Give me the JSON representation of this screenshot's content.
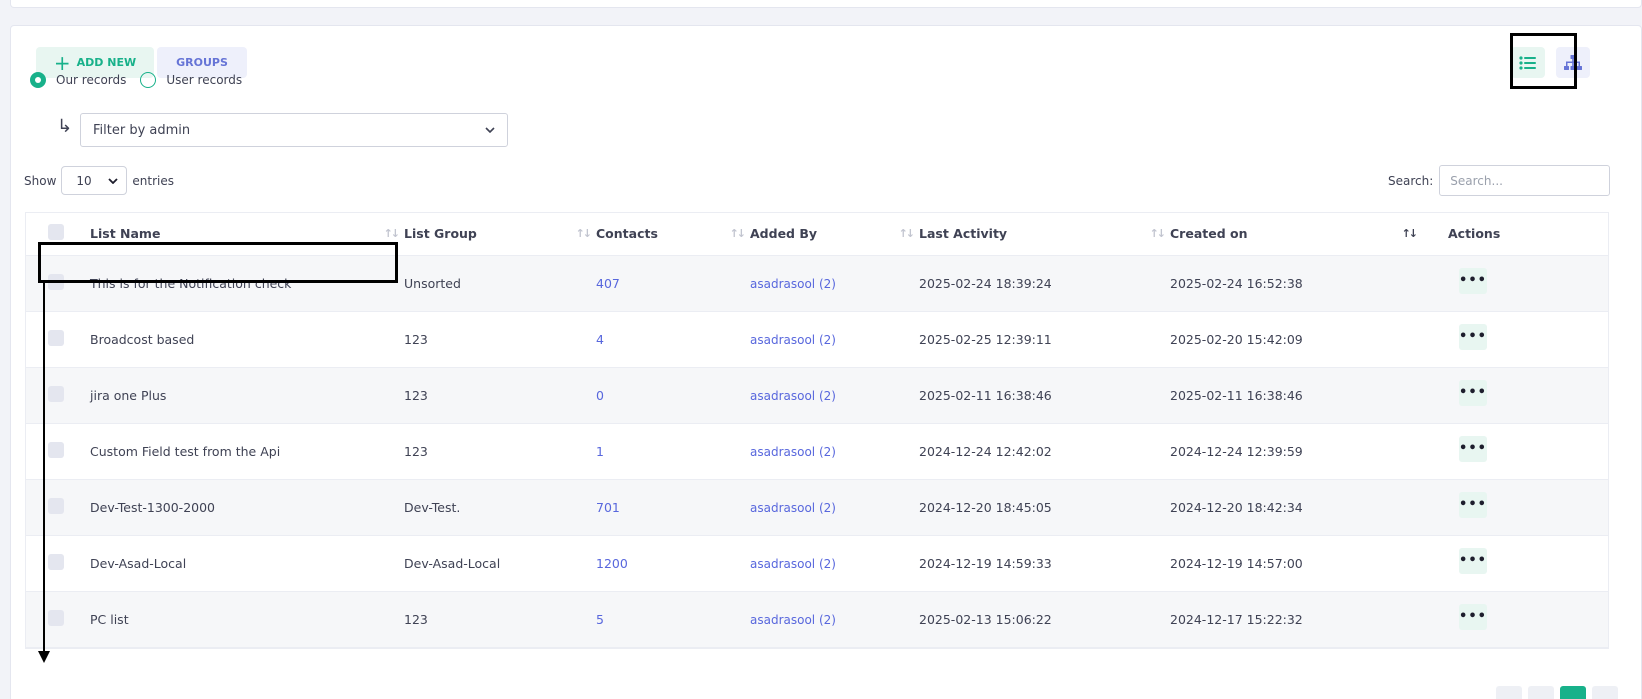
{
  "toolbar": {
    "add_new_label": "ADD NEW",
    "groups_label": "GROUPS"
  },
  "records_filter": {
    "options": [
      "Our records",
      "User records"
    ],
    "selected": "Our records"
  },
  "admin_filter": {
    "placeholder": "Filter by admin"
  },
  "length_menu": {
    "show_label": "Show",
    "value": "10",
    "entries_label": "entries"
  },
  "search": {
    "label": "Search:",
    "placeholder": "Search..."
  },
  "table": {
    "headers": {
      "name": "List Name",
      "group": "List Group",
      "contacts": "Contacts",
      "added_by": "Added By",
      "last_activity": "Last Activity",
      "created_on": "Created on",
      "actions": "Actions"
    },
    "rows": [
      {
        "name": "This is for the Notification check",
        "group": "Unsorted",
        "contacts": "407",
        "added_by": "asadrasool (2)",
        "last_activity": "2025-02-24 18:39:24",
        "created_on": "2025-02-24 16:52:38"
      },
      {
        "name": "Broadcost based",
        "group": "123",
        "contacts": "4",
        "added_by": "asadrasool (2)",
        "last_activity": "2025-02-25 12:39:11",
        "created_on": "2025-02-20 15:42:09"
      },
      {
        "name": "jira one Plus",
        "group": "123",
        "contacts": "0",
        "added_by": "asadrasool (2)",
        "last_activity": "2025-02-11 16:38:46",
        "created_on": "2025-02-11 16:38:46"
      },
      {
        "name": "Custom Field test from the Api",
        "group": "123",
        "contacts": "1",
        "added_by": "asadrasool (2)",
        "last_activity": "2024-12-24 12:42:02",
        "created_on": "2024-12-24 12:39:59"
      },
      {
        "name": "Dev-Test-1300-2000",
        "group": "Dev-Test.",
        "contacts": "701",
        "added_by": "asadrasool (2)",
        "last_activity": "2024-12-20 18:45:05",
        "created_on": "2024-12-20 18:42:34"
      },
      {
        "name": "Dev-Asad-Local",
        "group": "Dev-Asad-Local",
        "contacts": "1200",
        "added_by": "asadrasool (2)",
        "last_activity": "2024-12-19 14:59:33",
        "created_on": "2024-12-19 14:57:00"
      },
      {
        "name": "PC list",
        "group": "123",
        "contacts": "5",
        "added_by": "asadrasool (2)",
        "last_activity": "2025-02-13 15:06:22",
        "created_on": "2024-12-17 15:22:32"
      }
    ],
    "action_glyph": "•••"
  },
  "colors": {
    "accent": "#18b18a",
    "link": "#5867dd",
    "annotation": "#000000"
  }
}
